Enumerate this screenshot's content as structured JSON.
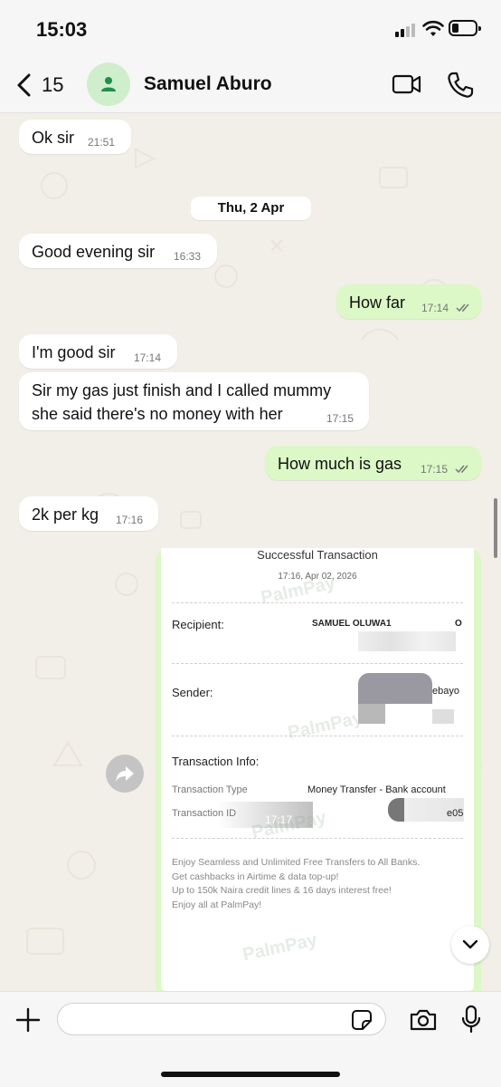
{
  "status": {
    "time": "15:03"
  },
  "header": {
    "back_count": "15",
    "contact_name": "Samuel Aburo"
  },
  "date_separator": "Thu, 2 Apr",
  "messages": [
    {
      "text": "Ok sir",
      "time": "21:51",
      "dir": "in"
    },
    {
      "text": "Good evening sir",
      "time": "16:33",
      "dir": "in"
    },
    {
      "text": "How far",
      "time": "17:14",
      "dir": "out"
    },
    {
      "text": "I'm good sir",
      "time": "17:14",
      "dir": "in"
    },
    {
      "text_line1": "Sir my gas just finish and I called mummy",
      "text_line2": "she said there's no money with her",
      "time": "17:15",
      "dir": "in"
    },
    {
      "text": "How much is gas",
      "time": "17:15",
      "dir": "out"
    },
    {
      "text": "2k per kg",
      "time": "17:16",
      "dir": "in"
    }
  ],
  "receipt": {
    "title": "Successful Transaction",
    "date": "17:16, Apr 02, 2026",
    "recipient_label": "Recipient:",
    "recipient_name": "SAMUEL OLUWA1",
    "recipient_suffix": "O",
    "sender_label": "Sender:",
    "sender_partial": "ebayo",
    "info_label": "Transaction Info:",
    "type_label": "Transaction Type",
    "type_value": "Money Transfer - Bank account",
    "id_label": "Transaction ID",
    "id_partial": "e05",
    "promo": [
      "Enjoy Seamless and Unlimited Free Transfers to All Banks.",
      "Get cashbacks in Airtime & data top-up!",
      "Up to 150k Naira credit lines & 16 days interest free!",
      "Enjoy all at PalmPay!"
    ],
    "watermark": "PalmPay",
    "time": "17:17"
  },
  "composer": {
    "placeholder": ""
  },
  "colors": {
    "outgoing_bubble": "#dcf8c6",
    "incoming_bubble": "#ffffff",
    "avatar_bg": "#cfeecb",
    "avatar_icon": "#1f8f4d"
  },
  "icons": [
    "back-chevron-icon",
    "person-icon",
    "video-call-icon",
    "phone-icon",
    "forward-icon",
    "chevron-down-icon",
    "plus-icon",
    "sticker-icon",
    "camera-icon",
    "microphone-icon",
    "double-check-icon"
  ]
}
